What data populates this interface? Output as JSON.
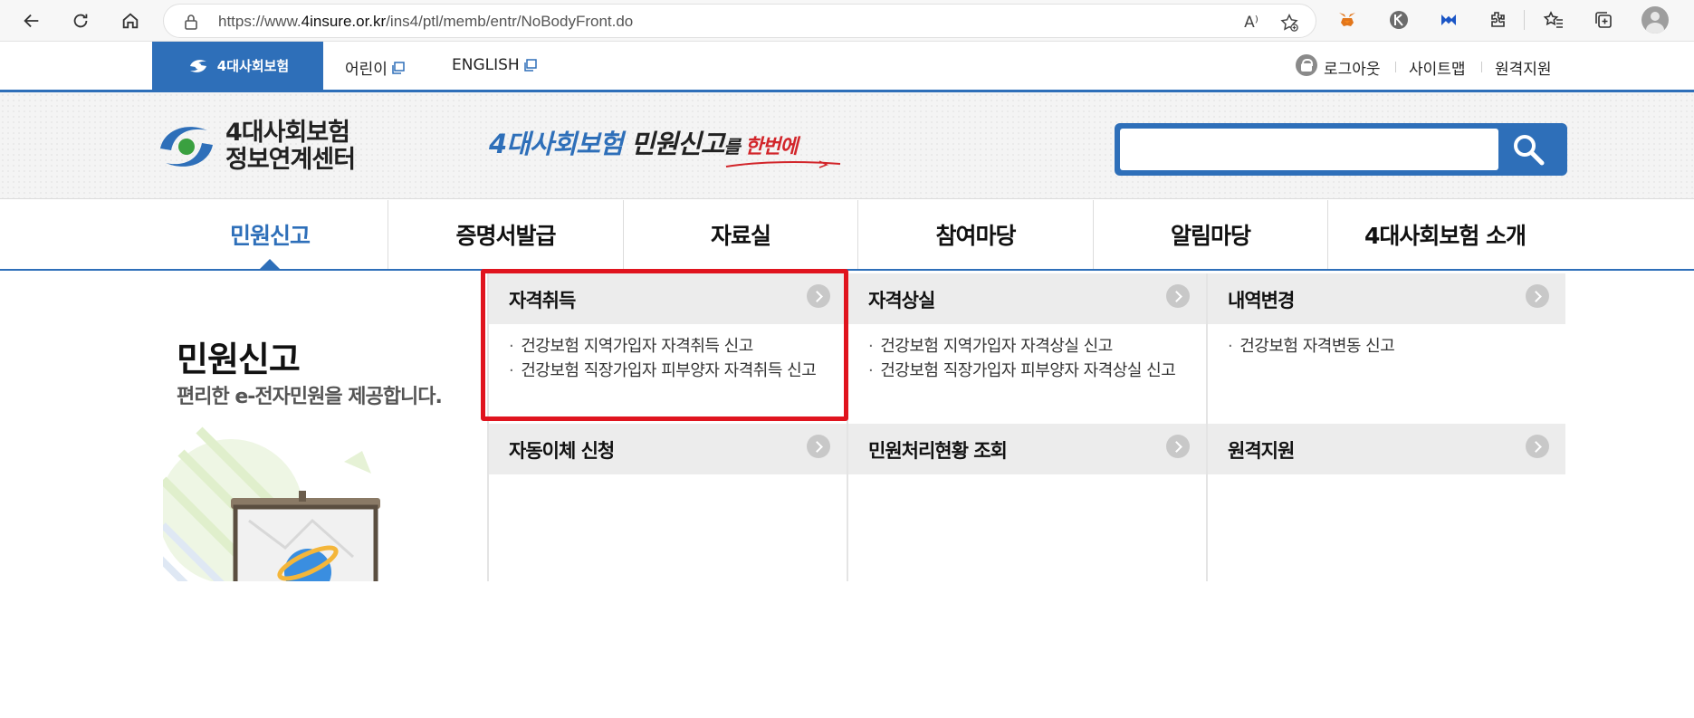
{
  "browser": {
    "url_prefix": "https://www.",
    "url_host": "4insure.or.kr",
    "url_path": "/ins4/ptl/memb/entr/NoBodyFront.do",
    "read_aloud_label": "A⁾"
  },
  "utility": {
    "brand_tab": "4대사회보험",
    "links": [
      "어린이",
      "ENGLISH"
    ],
    "right_links": [
      "로그아웃",
      "사이트맵",
      "원격지원"
    ]
  },
  "header": {
    "logo_line1": "4대사회보험",
    "logo_line2": "정보연계센터",
    "slogan_part1": "4대사회보험",
    "slogan_part2": " 민원신고",
    "slogan_part3": "를 ",
    "slogan_part4": "한번에",
    "search_placeholder": ""
  },
  "gnb": {
    "items": [
      "민원신고",
      "증명서발급",
      "자료실",
      "참여마당",
      "알림마당",
      "4대사회보험 소개"
    ],
    "active_index": 0
  },
  "intro": {
    "title": "민원신고",
    "subtitle": "편리한 e-전자민원을 제공합니다."
  },
  "menu": {
    "sections": [
      {
        "title": "자격취득",
        "items": [
          "건강보험 지역가입자 자격취득 신고",
          "건강보험 직장가입자 피부양자 자격취득 신고"
        ]
      },
      {
        "title": "자격상실",
        "items": [
          "건강보험 지역가입자 자격상실 신고",
          "건강보험 직장가입자 피부양자 자격상실 신고"
        ]
      },
      {
        "title": "내역변경",
        "items": [
          "건강보험 자격변동 신고"
        ]
      },
      {
        "title": "자동이체 신청",
        "items": []
      },
      {
        "title": "민원처리현황 조회",
        "items": []
      },
      {
        "title": "원격지원",
        "items": []
      }
    ]
  },
  "colors": {
    "brand_blue": "#2e6fb9",
    "highlight_red": "#e0141e",
    "panel_head_bg": "#ececec"
  }
}
